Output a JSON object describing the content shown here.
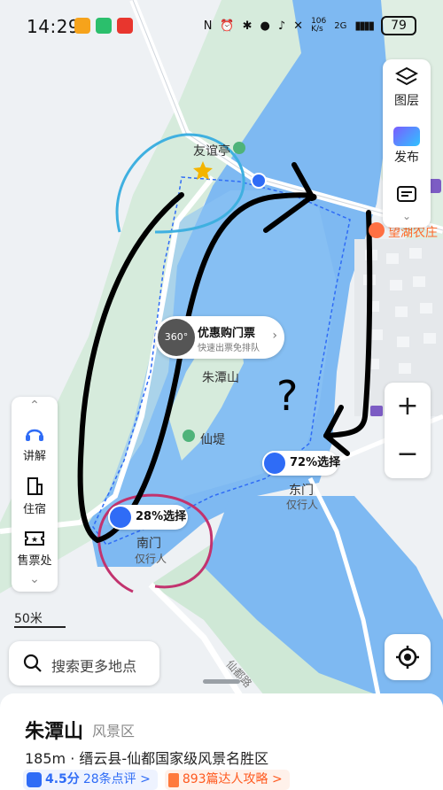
{
  "status_bar": {
    "time": "14:29",
    "net_speed": "106\nK/s",
    "signal_label": "2G",
    "battery": "79"
  },
  "map": {
    "labels": {
      "youyi_pavilion": "友谊亭",
      "wangjia_farm": "望湖农庄",
      "zhutanshan_center": "朱潭山",
      "xiandi": "仙堤",
      "dongmen": "东门",
      "dongmen_sub": "仅行人",
      "nanmen": "南门",
      "nanmen_sub": "仅行人",
      "road_label": "仙都路",
      "question_mark": "?"
    },
    "ticket_bubble": {
      "badge": "360°",
      "title": "优惠购门票",
      "subtitle": "快速出票免排队"
    },
    "entrance_pills": [
      {
        "id": "east",
        "text": "72%选择"
      },
      {
        "id": "south",
        "text": "28%选择"
      }
    ],
    "scale": "50米"
  },
  "right_tools": {
    "layers": "图层",
    "publish": "发布"
  },
  "left_tools": {
    "explain": "讲解",
    "lodging": "住宿",
    "ticket_office": "售票处"
  },
  "search": {
    "placeholder": "搜索更多地点"
  },
  "poi_card": {
    "title": "朱潭山",
    "category": "风景区",
    "address": "185m · 缙云县-仙都国家级风景名胜区",
    "rating": "4.5分",
    "reviews": "28条点评 >",
    "guides": "893篇达人攻略 >"
  },
  "colors": {
    "water": "#7eb9f2",
    "land": "#d9ece0",
    "road": "#f4f6f8",
    "accent": "#2f6cf6",
    "ink": "#000000",
    "pink": "#c2336e",
    "cyan": "#3fb0e0"
  }
}
